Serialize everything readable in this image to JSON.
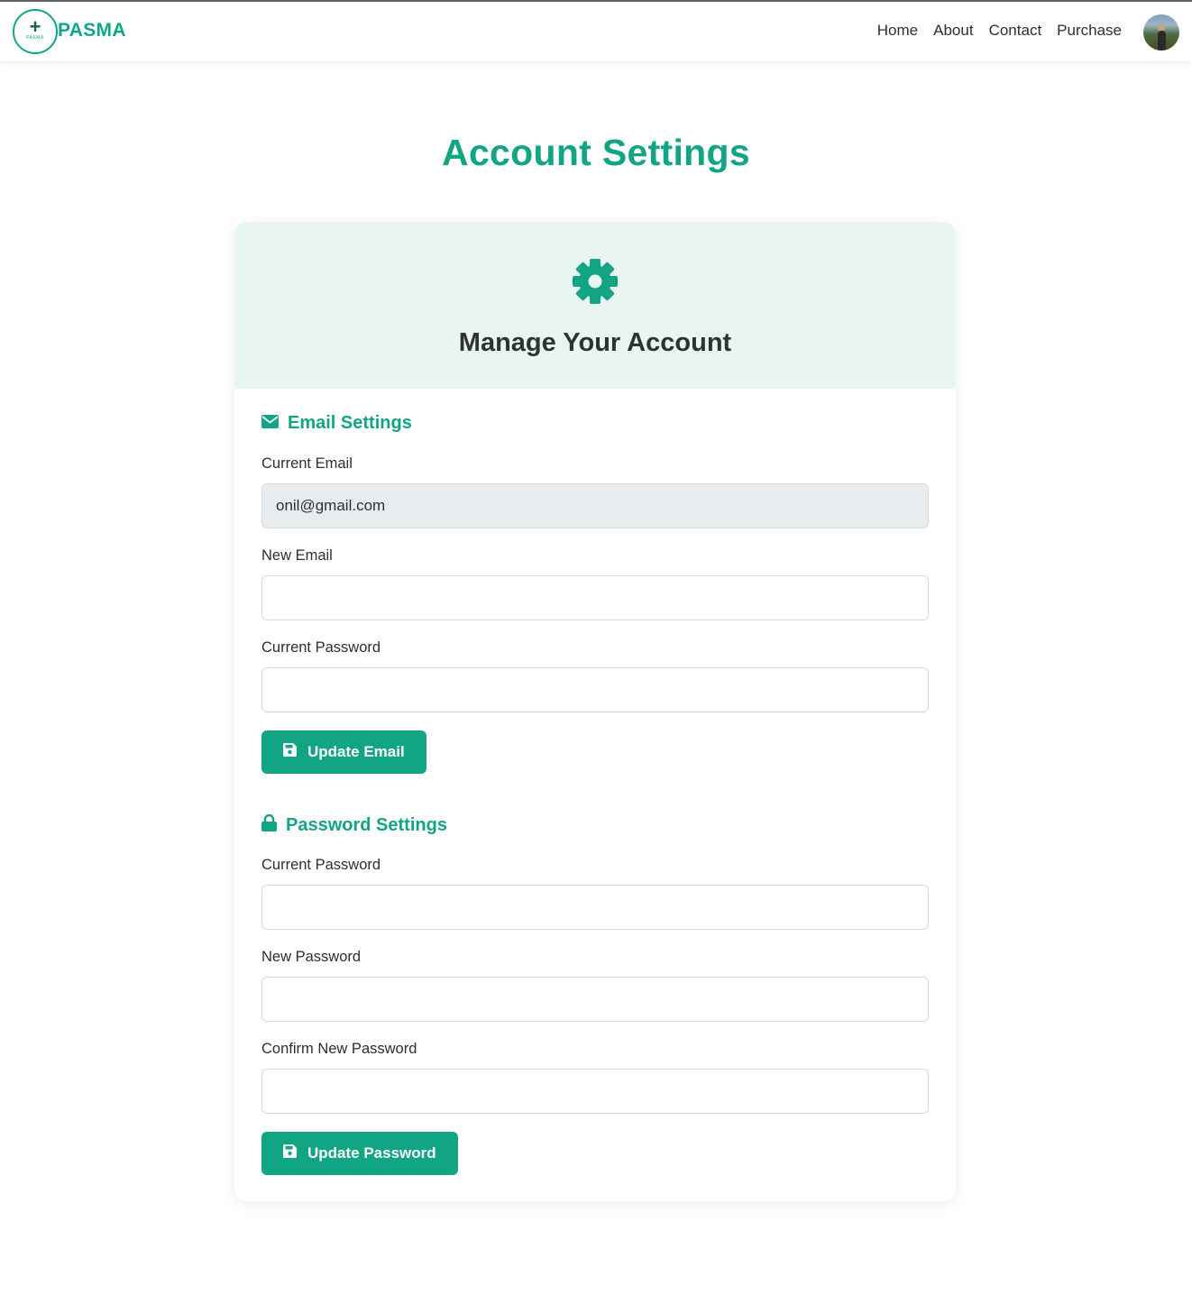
{
  "nav": {
    "brand": "PASMA",
    "links": [
      "Home",
      "About",
      "Contact",
      "Purchase"
    ]
  },
  "page": {
    "title": "Account Settings"
  },
  "card": {
    "title": "Manage Your Account"
  },
  "email_section": {
    "title": "Email Settings",
    "current_email_label": "Current Email",
    "current_email_value": "onil@gmail.com",
    "new_email_label": "New Email",
    "new_email_value": "",
    "current_password_label": "Current Password",
    "current_password_value": "",
    "button_label": "Update Email"
  },
  "password_section": {
    "title": "Password Settings",
    "current_password_label": "Current Password",
    "new_password_label": "New Password",
    "confirm_password_label": "Confirm New Password",
    "button_label": "Update Password"
  },
  "icons": {
    "settings": "gear-icon",
    "email": "envelope-icon",
    "password": "lock-icon",
    "save": "save-icon"
  },
  "colors": {
    "accent": "#12a584",
    "header_bg": "#e8f5f0",
    "readonly_input_bg": "#e9ecef"
  }
}
